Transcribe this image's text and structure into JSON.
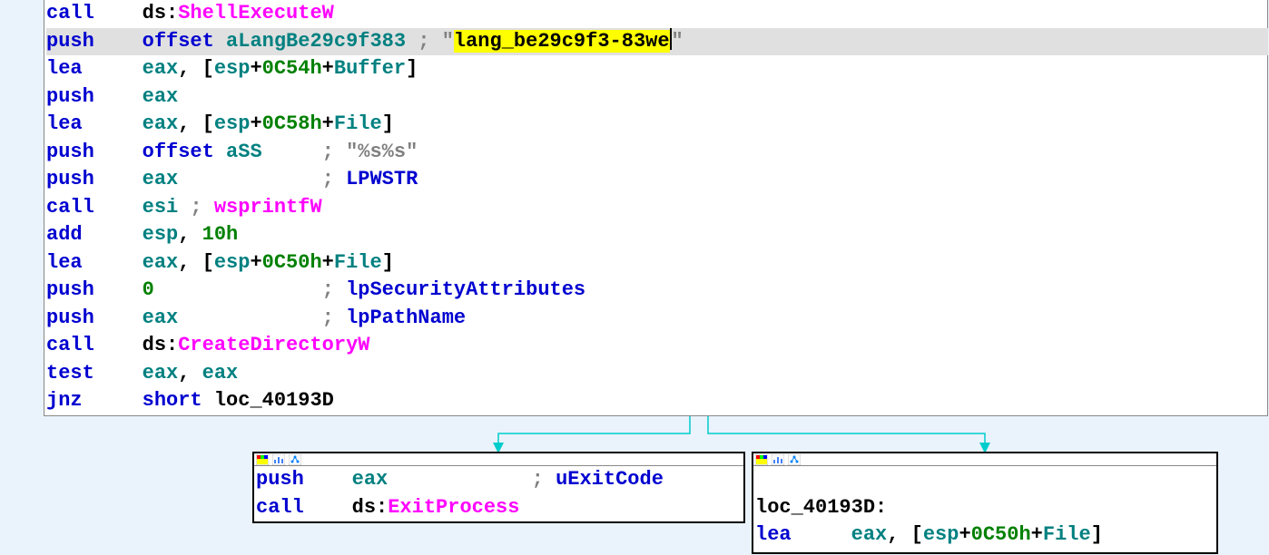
{
  "main": {
    "lines": [
      {
        "type": "partial_top",
        "mnem": "call",
        "op": "ds:",
        "pink": "ShellExecuteW"
      },
      {
        "type": "push_offset_str",
        "mnem": "push",
        "kw": "offset",
        "ident": "aLangBe29c9f383",
        "comment_prefix": " ; \"",
        "hl": "lang_be29c9f3-83we",
        "comment_suffix": "\"",
        "highlighted": true
      },
      {
        "type": "lea",
        "mnem": "lea",
        "reg": "eax",
        "punct": ", [",
        "reg2": "esp",
        "plus": "+",
        "num": "0C54h",
        "plus2": "+",
        "ident": "Buffer",
        "close": "]"
      },
      {
        "type": "simple",
        "mnem": "push",
        "op": "eax",
        "op_is_reg": true
      },
      {
        "type": "lea",
        "mnem": "lea",
        "reg": "eax",
        "punct": ", [",
        "reg2": "esp",
        "plus": "+",
        "num": "0C58h",
        "plus2": "+",
        "ident": "File",
        "close": "]"
      },
      {
        "type": "push_offset",
        "mnem": "push",
        "kw": "offset",
        "ident": "aSS",
        "pad": "     ",
        "comment": "; \"%s%s\""
      },
      {
        "type": "push_comment",
        "mnem": "push",
        "reg": "eax",
        "pad": "            ",
        "comment": "; ",
        "api": "LPWSTR"
      },
      {
        "type": "call_reg",
        "mnem": "call",
        "reg": "esi",
        "comment": " ; ",
        "pink": "wsprintfW"
      },
      {
        "type": "add",
        "mnem": "add",
        "reg": "esp",
        "punct": ", ",
        "num": "10h"
      },
      {
        "type": "lea",
        "mnem": "lea",
        "reg": "eax",
        "punct": ", [",
        "reg2": "esp",
        "plus": "+",
        "num": "0C50h",
        "plus2": "+",
        "ident": "File",
        "close": "]"
      },
      {
        "type": "push_comment",
        "mnem": "push",
        "num": "0",
        "pad": "              ",
        "comment": "; ",
        "api": "lpSecurityAttributes"
      },
      {
        "type": "push_comment",
        "mnem": "push",
        "reg": "eax",
        "pad": "            ",
        "comment": "; ",
        "api": "lpPathName"
      },
      {
        "type": "call_ds",
        "mnem": "call",
        "prefix": "ds:",
        "pink": "CreateDirectoryW"
      },
      {
        "type": "test",
        "mnem": "test",
        "reg": "eax",
        "punct": ", ",
        "reg2": "eax"
      },
      {
        "type": "jmp",
        "mnem": "jnz",
        "kw": "short",
        "ident": "loc_40193D"
      }
    ]
  },
  "left_block": {
    "lines": [
      {
        "mnem": "push",
        "reg": "eax",
        "pad": "            ",
        "comment": "; ",
        "api": "uExitCode"
      },
      {
        "mnem": "call",
        "prefix": "ds:",
        "pink": "ExitProcess"
      }
    ]
  },
  "right_block": {
    "label": "loc_40193D:",
    "line": {
      "mnem": "lea",
      "reg": "eax",
      "punct": ", [",
      "reg2": "esp",
      "plus": "+",
      "num": "0C50h",
      "plus2": "+",
      "ident": "File",
      "close": "]"
    }
  }
}
